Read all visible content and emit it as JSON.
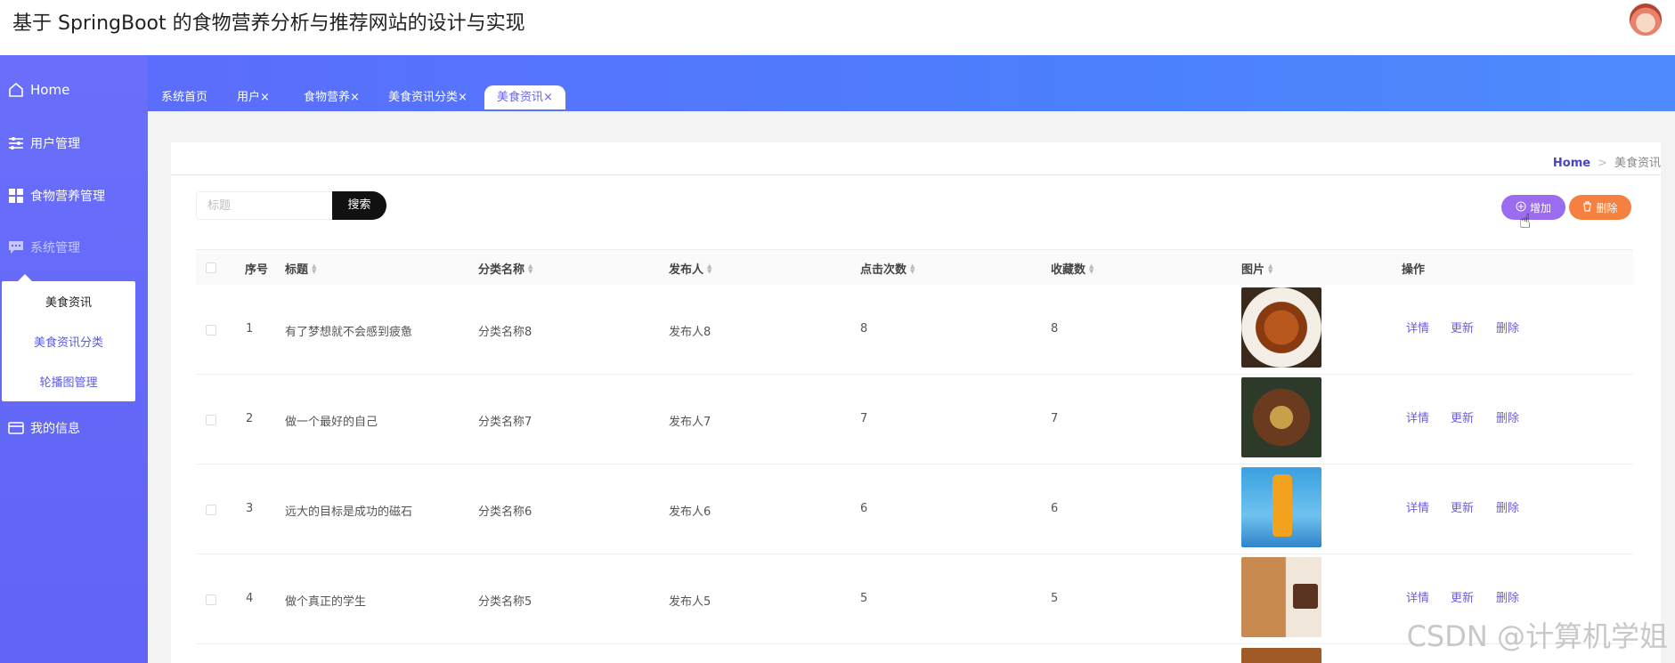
{
  "header": {
    "title": "基于 SpringBoot 的食物营养分析与推荐网站的设计与实现"
  },
  "sidebar": {
    "items": [
      {
        "label": "Home",
        "icon": "home-icon"
      },
      {
        "label": "用户管理",
        "icon": "sliders-icon"
      },
      {
        "label": "食物营养管理",
        "icon": "grid-icon"
      },
      {
        "label": "系统管理",
        "icon": "chat-icon"
      },
      {
        "label": "我的信息",
        "icon": "card-icon"
      }
    ],
    "submenu": [
      "美食资讯",
      "美食资讯分类",
      "轮播图管理"
    ]
  },
  "tabs": [
    "系统首页",
    "用户×",
    "食物营养×",
    "美食资讯分类×",
    "美食资讯×"
  ],
  "breadcrumb": {
    "home": "Home",
    "sep": ">",
    "current": "美食资讯"
  },
  "search": {
    "placeholder": "标题",
    "button": "搜索"
  },
  "actions": {
    "add": "增加",
    "delete": "删除"
  },
  "table": {
    "headers": [
      "序号",
      "标题",
      "分类名称",
      "发布人",
      "点击次数",
      "收藏数",
      "图片",
      "操作"
    ],
    "rows": [
      {
        "no": "1",
        "title": "有了梦想就不会感到疲惫",
        "category": "分类名称8",
        "publisher": "发布人8",
        "clicks": "8",
        "favorites": "8"
      },
      {
        "no": "2",
        "title": "做一个最好的自己",
        "category": "分类名称7",
        "publisher": "发布人7",
        "clicks": "7",
        "favorites": "7"
      },
      {
        "no": "3",
        "title": "远大的目标是成功的磁石",
        "category": "分类名称6",
        "publisher": "发布人6",
        "clicks": "6",
        "favorites": "6"
      },
      {
        "no": "4",
        "title": "做个真正的学生",
        "category": "分类名称5",
        "publisher": "发布人5",
        "clicks": "5",
        "favorites": "5"
      }
    ],
    "ops": {
      "detail": "详情",
      "update": "更新",
      "delete": "删除"
    }
  },
  "watermark": "CSDN @计算机学姐"
}
